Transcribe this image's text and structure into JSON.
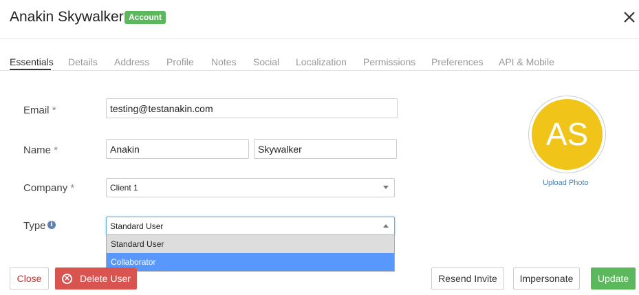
{
  "header": {
    "title": "Anakin Skywalker",
    "badge": "Account",
    "close_icon": "close-x-icon"
  },
  "tabs": [
    {
      "label": "Essentials",
      "active": true
    },
    {
      "label": "Details"
    },
    {
      "label": "Address"
    },
    {
      "label": "Profile"
    },
    {
      "label": "Notes"
    },
    {
      "label": "Social"
    },
    {
      "label": "Localization"
    },
    {
      "label": "Permissions"
    },
    {
      "label": "Preferences"
    },
    {
      "label": "API & Mobile"
    }
  ],
  "form": {
    "email": {
      "label": "Email",
      "required_mark": "*",
      "value": "testing@testanakin.com"
    },
    "name": {
      "label": "Name",
      "required_mark": "*",
      "first": "Anakin",
      "last": "Skywalker"
    },
    "company": {
      "label": "Company",
      "required_mark": "*",
      "value": "Client 1"
    },
    "type": {
      "label": "Type",
      "info_icon": "info-icon",
      "value": "Standard User",
      "options": [
        "Standard User",
        "Collaborator"
      ],
      "highlighted_option": "Collaborator"
    }
  },
  "avatar": {
    "initials": "AS",
    "upload_label": "Upload Photo"
  },
  "buttons": {
    "close": "Close",
    "delete": "Delete User",
    "resend": "Resend Invite",
    "impersonate": "Impersonate",
    "update": "Update"
  },
  "colors": {
    "badge": "#5cb85c",
    "avatar": "#f0c419",
    "danger": "#d9534f",
    "success": "#5cb85c",
    "highlight": "#5897fb"
  }
}
